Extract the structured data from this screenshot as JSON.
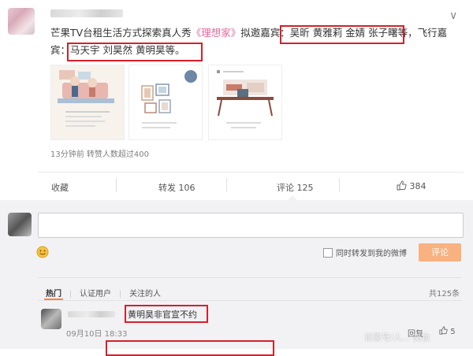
{
  "post": {
    "body_text_pre": "芒果TV台租生活方式探索真人秀",
    "show_title": "《理想家》",
    "body_text_mid": "拟邀嘉宾：",
    "guests_group_1": "吴昕 黄雅莉 金婧 张子曙等",
    "body_text_flying": "，飞行嘉",
    "body_text_line2_pre": "宾：",
    "guests_group_2": "马天宇 刘昊然 黄明昊等。",
    "meta": "13分钟前 转赞人数超过400",
    "chevron": "∨"
  },
  "actions": {
    "collect": "收藏",
    "repost": "转发 106",
    "comment": "评论 125",
    "like_count": "384"
  },
  "composer": {
    "sync_label": "同时转发到我的微博",
    "submit_label": "评论"
  },
  "comment_tabs": {
    "hot": "热门",
    "verified": "认证用户",
    "follow": "关注的人",
    "total": "共125条"
  },
  "comment": {
    "text": "黄明昊非官宣不约",
    "time": "09月10日 18:33",
    "reply": "回复",
    "likes": "5"
  },
  "watermark": "百家号/人... 美妆"
}
